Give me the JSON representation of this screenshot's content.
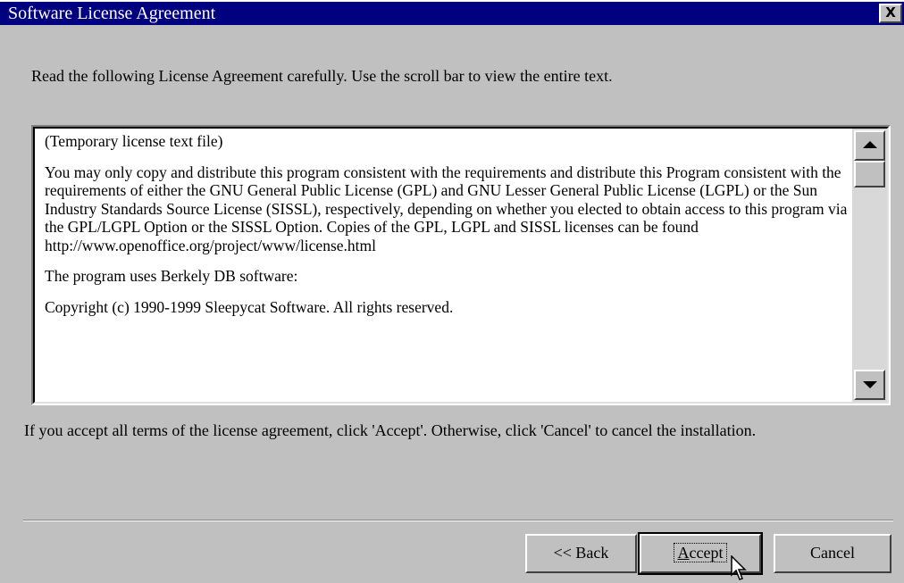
{
  "window": {
    "title": "Software License Agreement",
    "close_glyph": "X"
  },
  "instruction": "Read the following License Agreement carefully. Use the scroll bar to view the entire text.",
  "license_text": {
    "paragraphs": [
      "(Temporary license text file)",
      "You may only copy and distribute this program consistent with the requirements and distribute this Program consistent with the requirements of either the GNU General Public License (GPL) and GNU Lesser General Public License (LGPL) or the Sun Industry Standards Source License (SISSL), respectively, depending on whether you elected to obtain access to this program via the GPL/LGPL Option or the SISSL Option. Copies of the GPL, LGPL and SISSL licenses can be found http://www.openoffice.org/project/www/license.html",
      "The program uses Berkely DB software:",
      "Copyright (c) 1990-1999 Sleepycat Software.  All rights reserved."
    ]
  },
  "accept_prompt": "If you accept all terms of the license agreement, click 'Accept'. Otherwise, click 'Cancel' to cancel the installation.",
  "buttons": {
    "back": "<< Back",
    "accept_first": "A",
    "accept_rest": "ccept",
    "cancel": "Cancel"
  },
  "icons": {
    "close": "close-icon",
    "scroll_up": "scroll-up-arrow-icon",
    "scroll_down": "scroll-down-arrow-icon",
    "cursor": "mouse-pointer-icon"
  },
  "colors": {
    "titlebar": "#000080",
    "face": "#c0c0c0",
    "text_area": "#ffffff"
  }
}
